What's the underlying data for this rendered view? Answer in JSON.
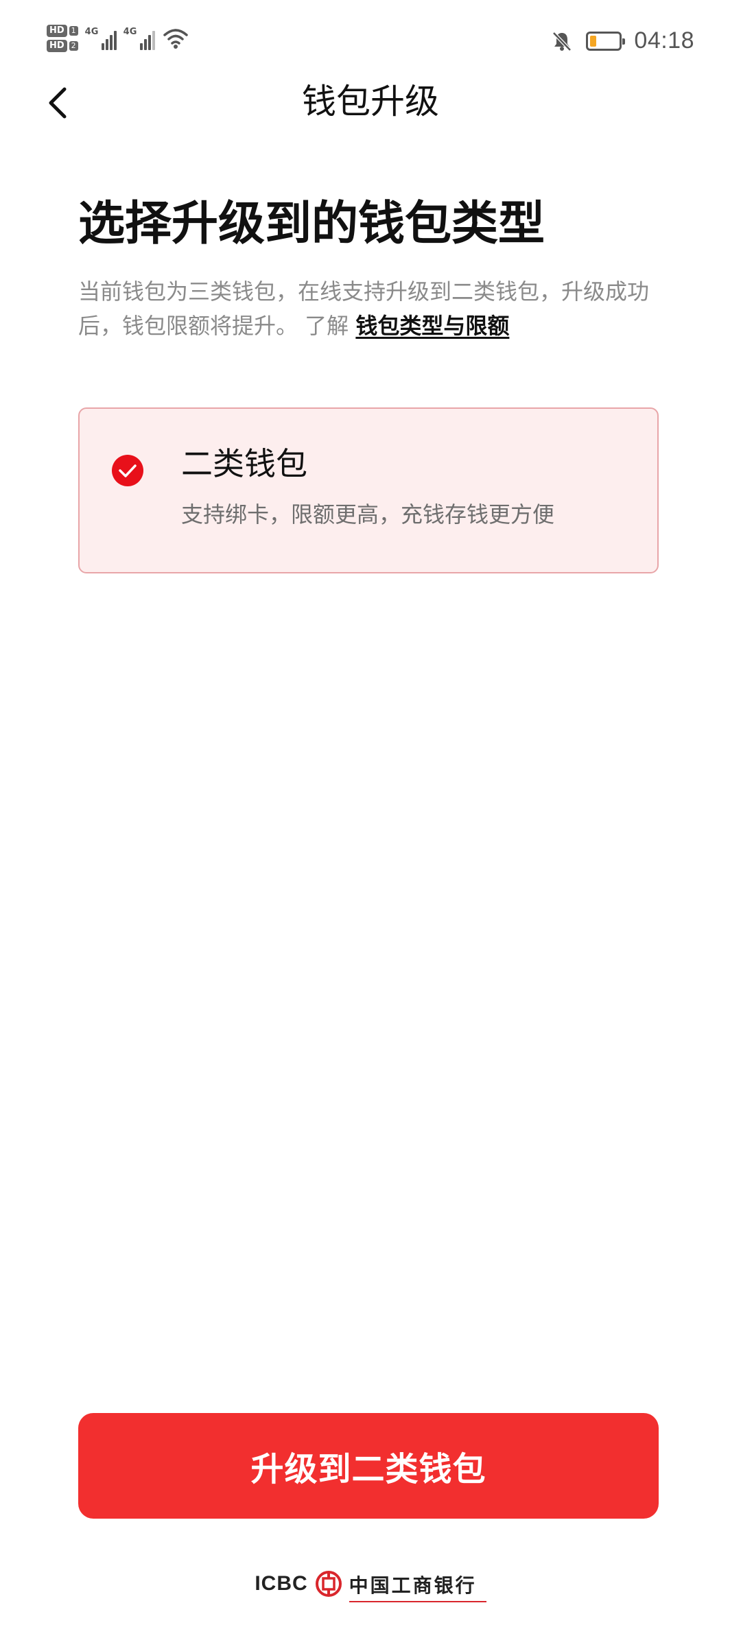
{
  "status_bar": {
    "hd1": "HD",
    "hd1_num": "1",
    "hd2": "HD",
    "hd2_num": "2",
    "net1": "4G",
    "net2": "4G",
    "time": "04:18",
    "battery_level": 0.15,
    "icons": [
      "signal-icon",
      "wifi-icon",
      "bell-muted-icon",
      "battery-icon"
    ]
  },
  "nav": {
    "back_icon": "chevron-left-icon",
    "title": "钱包升级"
  },
  "header": {
    "title": "选择升级到的钱包类型",
    "description": "当前钱包为三类钱包，在线支持升级到二类钱包，升级成功后，钱包限额将提升。 了解 ",
    "link_label": "钱包类型与限额"
  },
  "option": {
    "selected": true,
    "icon": "check-circle-icon",
    "title": "二类钱包",
    "subtitle": "支持绑卡，限额更高，充钱存钱更方便"
  },
  "actions": {
    "upgrade_label": "升级到二类钱包"
  },
  "footer": {
    "logo_text": "ICBC",
    "bank_name": "中国工商银行"
  },
  "colors": {
    "accent": "#f22f2f",
    "card_bg": "#fdeeee",
    "card_border": "#e8a5a8",
    "muted_text": "#8a8a8a"
  }
}
